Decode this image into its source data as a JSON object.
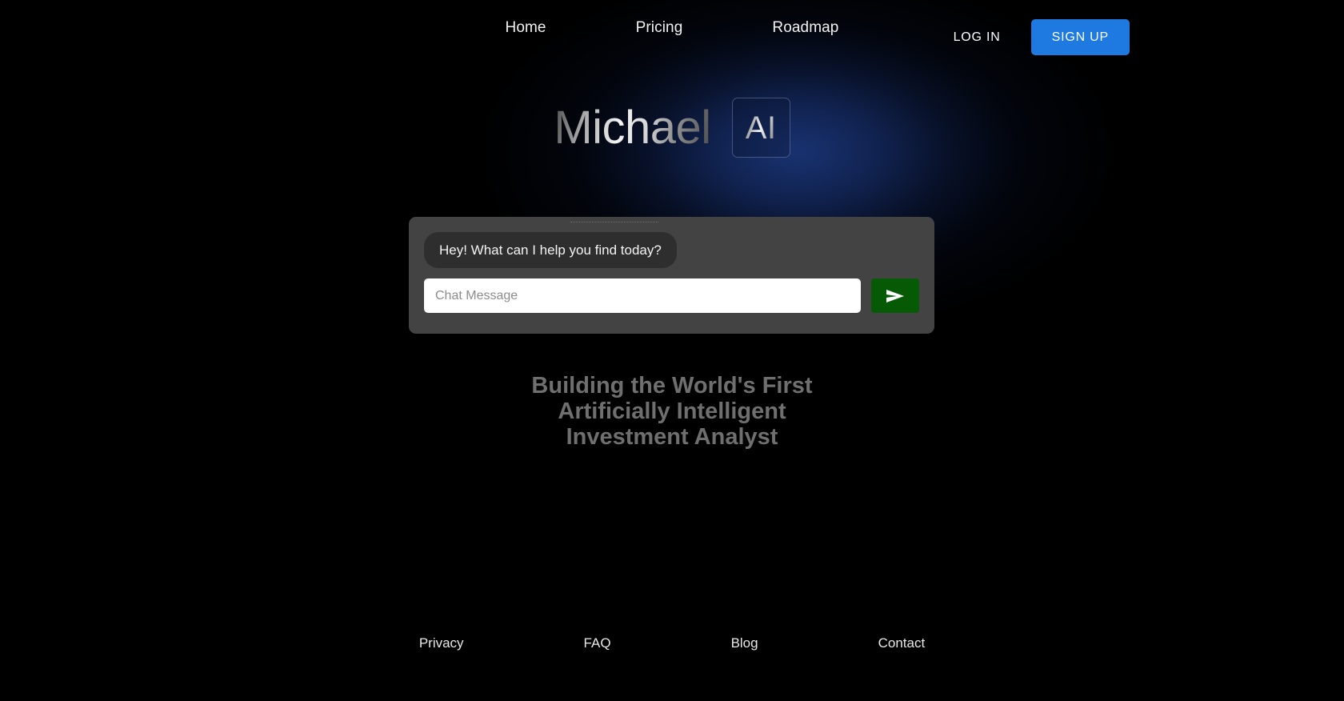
{
  "theme": {
    "background": "#000000",
    "accent_blue": "#1e7ae0",
    "glow_blue": "#1a3678",
    "panel_gray": "#434343",
    "bubble_gray": "#2e2e2e",
    "send_green": "#065a06",
    "headline_gray": "#6f6f6f"
  },
  "nav": {
    "links": [
      {
        "label": "Home"
      },
      {
        "label": "Pricing"
      },
      {
        "label": "Roadmap"
      }
    ],
    "login_label": "LOG IN",
    "signup_label": "SIGN UP"
  },
  "logo": {
    "wordmark": "Michael",
    "badge": "AI"
  },
  "chat": {
    "greeting": "Hey! What can I help you find today?",
    "input_value": "",
    "input_placeholder": "Chat Message",
    "send_icon": "send-arrow-icon"
  },
  "hero": {
    "headline_lines": [
      "Building the World's First",
      "Artificially Intelligent",
      "Investment Analyst"
    ]
  },
  "footer": {
    "links": [
      {
        "label": "Privacy"
      },
      {
        "label": "FAQ"
      },
      {
        "label": "Blog"
      },
      {
        "label": "Contact"
      }
    ]
  }
}
